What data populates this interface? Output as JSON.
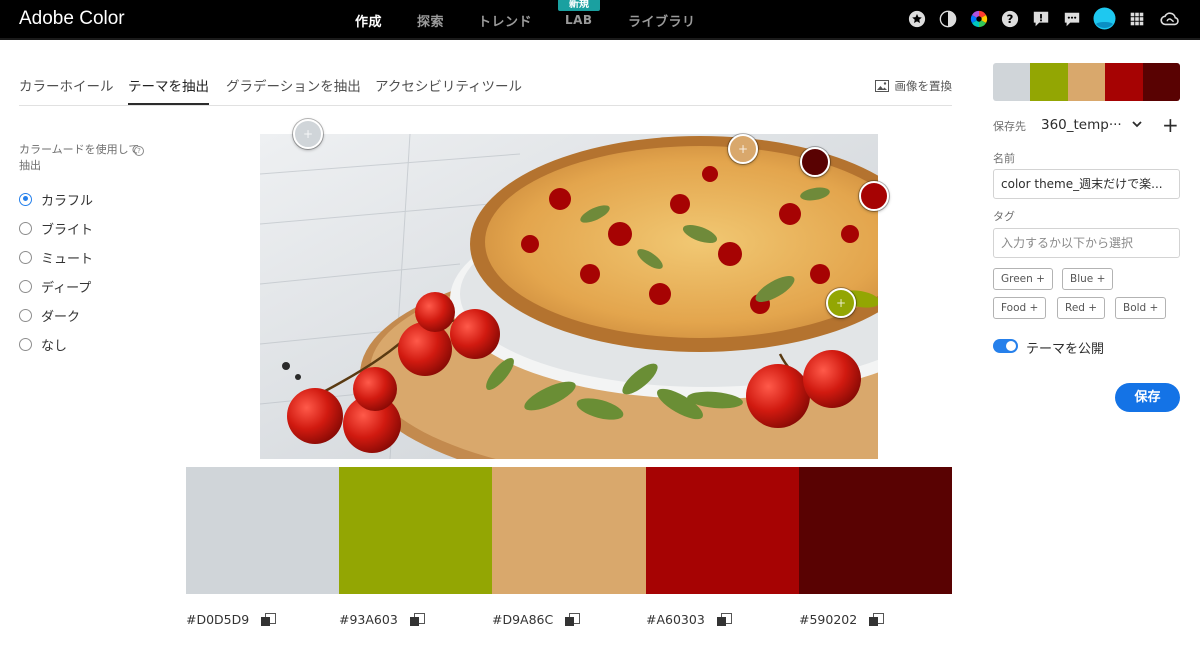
{
  "app": {
    "title": "Adobe Color"
  },
  "nav": {
    "items": [
      {
        "label": "作成",
        "active": true
      },
      {
        "label": "探索",
        "active": false
      },
      {
        "label": "トレンド",
        "active": false
      },
      {
        "label": "LAB",
        "active": false,
        "badge": "新規"
      },
      {
        "label": "ライブラリ",
        "active": false
      }
    ],
    "icons": [
      "star-icon",
      "contrast-icon",
      "color-wheel-icon",
      "help-icon",
      "feedback-icon",
      "chat-icon",
      "avatar",
      "apps-grid-icon",
      "creative-cloud-icon"
    ]
  },
  "tabs": [
    {
      "label": "カラーホイール",
      "active": false
    },
    {
      "label": "テーマを抽出",
      "active": true
    },
    {
      "label": "グラデーションを抽出",
      "active": false
    },
    {
      "label": "アクセシビリティツール",
      "active": false
    }
  ],
  "replace_image": {
    "label": "画像を置換"
  },
  "mode": {
    "label": "カラームードを使用して抽出",
    "help": "?",
    "options": [
      {
        "label": "カラフル",
        "selected": true
      },
      {
        "label": "ブライト",
        "selected": false
      },
      {
        "label": "ミュート",
        "selected": false
      },
      {
        "label": "ディープ",
        "selected": false
      },
      {
        "label": "ダーク",
        "selected": false
      },
      {
        "label": "なし",
        "selected": false
      }
    ]
  },
  "theme": {
    "colors": [
      "#D0D5D9",
      "#93A603",
      "#D9A86C",
      "#A60303",
      "#590202"
    ],
    "hex_labels": [
      "#D0D5D9",
      "#93A603",
      "#D9A86C",
      "#A60303",
      "#590202"
    ]
  },
  "pickers": [
    {
      "color": "#D0D5D9",
      "symbol": "+"
    },
    {
      "color": "#D9A86C",
      "symbol": "+"
    },
    {
      "color": "#590202",
      "symbol": ""
    },
    {
      "color": "#A60303",
      "symbol": ""
    },
    {
      "color": "#93A603",
      "symbol": "+"
    }
  ],
  "panel": {
    "save_to_label": "保存先",
    "library_value": "360_temp···",
    "add_symbol": "+",
    "name_label": "名前",
    "name_value": "color theme_週末だけで楽...",
    "tag_label": "タグ",
    "tag_placeholder": "入力するか以下から選択",
    "tag_suggestions": [
      "Green",
      "Blue",
      "Food",
      "Red",
      "Bold"
    ],
    "publish_label": "テーマを公開",
    "publish_on": true,
    "save_label": "保存"
  }
}
